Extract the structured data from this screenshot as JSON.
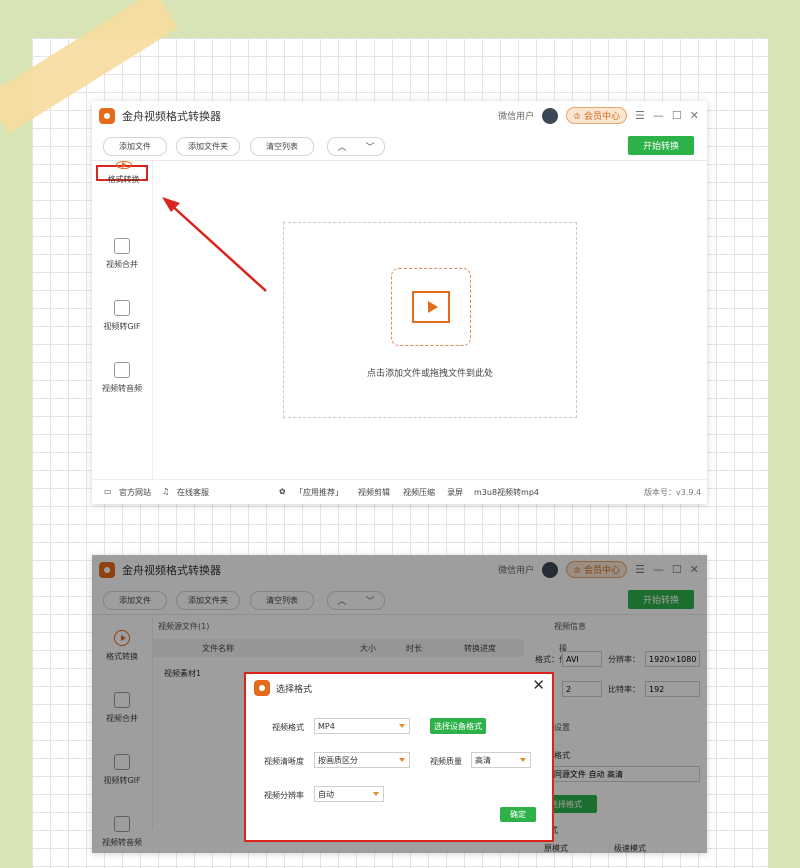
{
  "app": {
    "title": "金舟视频格式转换器",
    "user": "微信用户",
    "vip": "会员中心"
  },
  "toolbar": {
    "add_file": "添加文件",
    "add_folder": "添加文件夹",
    "clear_list": "清空列表",
    "start": "开始转换"
  },
  "sidebar": {
    "items": [
      {
        "label": "格式转换",
        "icon": "play-circle-icon"
      },
      {
        "label": "视频合并",
        "icon": "merge-icon"
      },
      {
        "label": "视频转GIF",
        "icon": "gif-icon"
      },
      {
        "label": "视频转音频",
        "icon": "music-icon"
      }
    ]
  },
  "main": {
    "drop_text": "点击添加文件或拖拽文件到此处"
  },
  "statusbar": {
    "website": "官方网站",
    "service": "在线客服",
    "recommend": "「应用推荐」",
    "links": [
      "视频剪辑",
      "视频压缩",
      "录屏",
      "m3u8视频转mp4"
    ],
    "version": "版本号：v3.9.4"
  },
  "window2": {
    "source_header": "视频源文件(1)",
    "columns": [
      "文件名称",
      "大小",
      "时长",
      "转换进度",
      "操作"
    ],
    "row": "视频素材1",
    "info_header": "视频信息",
    "info": {
      "format_label": "格式：",
      "format": "AVI",
      "resolution_label": "分辨率：",
      "resolution": "1920×1080",
      "fps": "2",
      "bitrate_label": "比特率：",
      "bitrate": "192"
    },
    "settings_header": "设置",
    "out_format_label": "格式",
    "out_format_value": "MV 同源文件 自动 高清",
    "choose_format_btn": "选择格式",
    "mode_label": "模式",
    "mode1": "原模式",
    "mode2": "极速模式"
  },
  "dialog": {
    "title": "选择格式",
    "video_format_label": "视频格式",
    "video_format": "MP4",
    "device_btn": "选择设备格式",
    "clarity_label": "视频清晰度",
    "clarity": "按画质区分",
    "quality_label": "视频质量",
    "quality": "高清",
    "resolution_label": "视频分辨率",
    "resolution": "自动",
    "ok": "确定"
  }
}
